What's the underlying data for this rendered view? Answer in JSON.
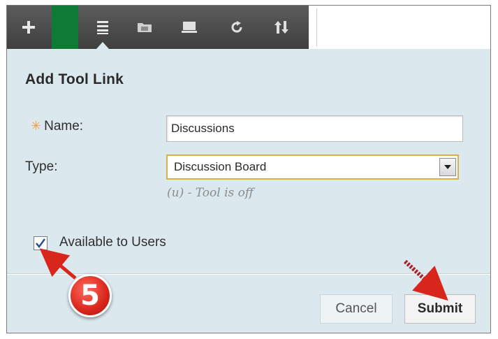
{
  "toolbar": {
    "buttons": [
      {
        "icon": "plus-icon"
      },
      {
        "icon": "list-icon"
      },
      {
        "icon": "folder-icon"
      },
      {
        "icon": "display-icon"
      },
      {
        "icon": "refresh-icon"
      },
      {
        "icon": "sort-icon"
      }
    ],
    "accent_color": "#0e7a33"
  },
  "panel": {
    "title": "Add Tool Link",
    "name_label": "Name:",
    "name_value": "Discussions",
    "type_label": "Type:",
    "type_value": "Discussion Board",
    "type_hint": "(u) - Tool is off",
    "available_label": "Available to Users",
    "available_checked": true,
    "cancel_label": "Cancel",
    "submit_label": "Submit"
  },
  "annotation": {
    "step_number": "5",
    "color": "#d8261c"
  }
}
